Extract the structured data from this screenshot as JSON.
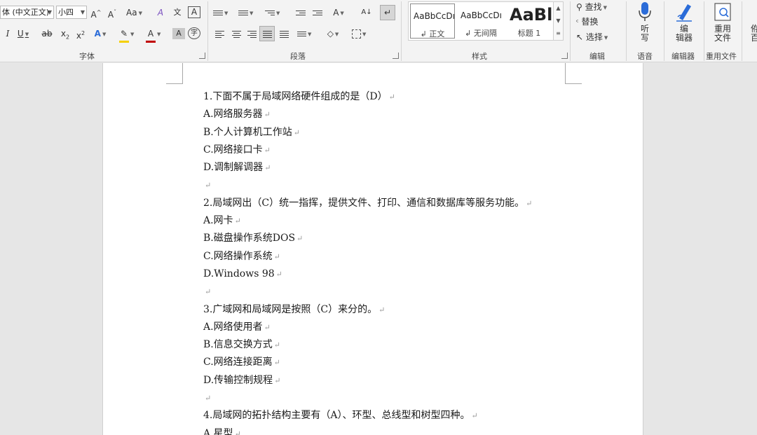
{
  "ribbon": {
    "font_group": {
      "label": "字体",
      "font_name": "体 (中文正文)",
      "font_size": "小四",
      "grow_font": "A^",
      "shrink_font": "Aˇ",
      "change_case": "Aa",
      "clear_format": "A",
      "phonetic": "文",
      "char_border": "A",
      "italic": "I",
      "underline": "U",
      "strike": "ab",
      "subscript": "x",
      "superscript": "x",
      "text_effects": "A",
      "font_color": "A",
      "char_shading": "A",
      "enclose": "字"
    },
    "paragraph_group": {
      "label": "段落"
    },
    "styles_group": {
      "label": "样式",
      "items": [
        {
          "sample": "AaBbCcDı",
          "name": "↲ 正文"
        },
        {
          "sample": "AaBbCcDı",
          "name": "↲ 无间隔"
        },
        {
          "sample": "AaBl",
          "name": "标题 1"
        }
      ]
    },
    "editing_group": {
      "label": "编辑",
      "find": "查找",
      "replace": "替换",
      "select": "选择"
    },
    "voice_group": {
      "label": "语音",
      "dictate": "听\n写"
    },
    "editor_group": {
      "label": "编辑器",
      "editor": "编\n辑器"
    },
    "reuse_group": {
      "label": "重用文件",
      "reuse": "重用\n文件"
    },
    "partial_group": {
      "label": "百",
      "button": "侟\n百"
    },
    "colors": {
      "highlight": "#f5d000",
      "font_color": "#c00000",
      "accent": "#2b579a"
    }
  },
  "document": {
    "paragraph_mark": "↵",
    "paragraphs": [
      "1.下面不属于局域网络硬件组成的是（D）",
      "A.网络服务器",
      "B.个人计算机工作站",
      "C.网络接口卡",
      "D.调制解调器",
      "",
      "2.局域网出（C）统一指挥，提供文件、打印、通信和数据库等服务功能。",
      "A.网卡",
      "B.磁盘操作系统DOS",
      "C.网络操作系统",
      "D.Windows 98",
      "",
      "3.广域网和局域网是按照（C）来分的。",
      "A.网络使用者",
      "B.信息交换方式",
      "C.网络连接距离",
      "D.传输控制规程",
      "",
      "4.局域网的拓扑结构主要有（A）、环型、总线型和树型四种。",
      "A.星型"
    ]
  }
}
